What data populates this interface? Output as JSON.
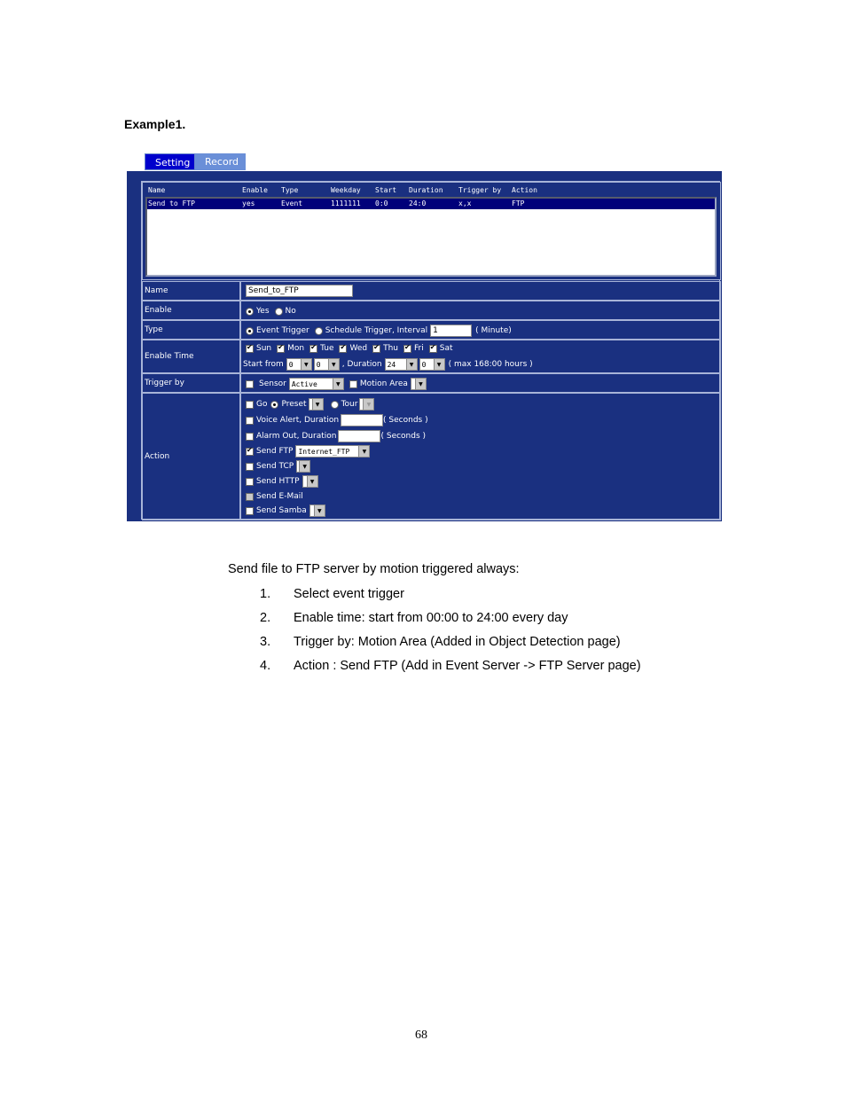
{
  "heading": "Example1.",
  "tabs": [
    {
      "label": "Setting",
      "active": true
    },
    {
      "label": "Record",
      "active": false
    }
  ],
  "event_list": {
    "columns": [
      "Name",
      "Enable",
      "Type",
      "Weekday",
      "Start",
      "Duration",
      "Trigger by",
      "Action"
    ],
    "rows": [
      {
        "name": "Send to FTP",
        "enable": "yes",
        "type": "Event",
        "weekday": "1111111",
        "start": "0:0",
        "duration": "24:0",
        "trigger_by": "x,x",
        "action": "FTP"
      }
    ]
  },
  "form": {
    "name": {
      "label": "Name",
      "value": "Send_to_FTP"
    },
    "enable": {
      "label": "Enable",
      "options": [
        "Yes",
        "No"
      ],
      "selected": "Yes"
    },
    "type": {
      "label": "Type",
      "options": [
        "Event Trigger",
        "Schedule Trigger, Interval"
      ],
      "selected": "Event Trigger",
      "interval_value": "1",
      "interval_unit": "( Minute)"
    },
    "enable_time": {
      "label": "Enable Time",
      "days": [
        {
          "label": "Sun",
          "checked": true
        },
        {
          "label": "Mon",
          "checked": true
        },
        {
          "label": "Tue",
          "checked": true
        },
        {
          "label": "Wed",
          "checked": true
        },
        {
          "label": "Thu",
          "checked": true
        },
        {
          "label": "Fri",
          "checked": true
        },
        {
          "label": "Sat",
          "checked": true
        }
      ],
      "start_from_label": "Start from",
      "start_hour": "0",
      "start_min": "0",
      "duration_label": ", Duration",
      "duration_hour": "24",
      "duration_min": "0",
      "max_note": "( max 168:00 hours )"
    },
    "trigger_by": {
      "label": "Trigger by",
      "sensor_label": "Sensor",
      "sensor_checked": false,
      "sensor_value": "Active",
      "motion_label": "Motion Area",
      "motion_checked": false,
      "motion_value": ""
    },
    "action": {
      "label": "Action",
      "go_label": "Go",
      "go_checked": false,
      "preset_label": "Preset",
      "tour_label": "Tour",
      "preset_selected": "Preset",
      "voice_label": "Voice Alert, Duration",
      "voice_checked": false,
      "voice_value": "",
      "voice_unit": "( Seconds )",
      "alarm_label": "Alarm Out, Duration",
      "alarm_checked": false,
      "alarm_value": "",
      "alarm_unit": "( Seconds )",
      "ftp_label": "Send FTP",
      "ftp_checked": true,
      "ftp_value": "Internet_FTP",
      "tcp_label": "Send TCP",
      "tcp_checked": false,
      "http_label": "Send HTTP",
      "http_checked": false,
      "email_label": "Send E-Mail",
      "email_checked": false,
      "samba_label": "Send Samba",
      "samba_checked": false
    }
  },
  "description": {
    "intro": "Send file to FTP server by motion triggered always:",
    "steps": [
      {
        "num": "1.",
        "text": "Select event trigger"
      },
      {
        "num": "2.",
        "text": "Enable time: start from 00:00 to 24:00 every day"
      },
      {
        "num": "3.",
        "text": "Trigger by: Motion Area (Added in Object Detection page)"
      },
      {
        "num": "4.",
        "text": "Action : Send FTP (Add in Event Server -> FTP Server page)"
      }
    ]
  },
  "page_number": "68"
}
